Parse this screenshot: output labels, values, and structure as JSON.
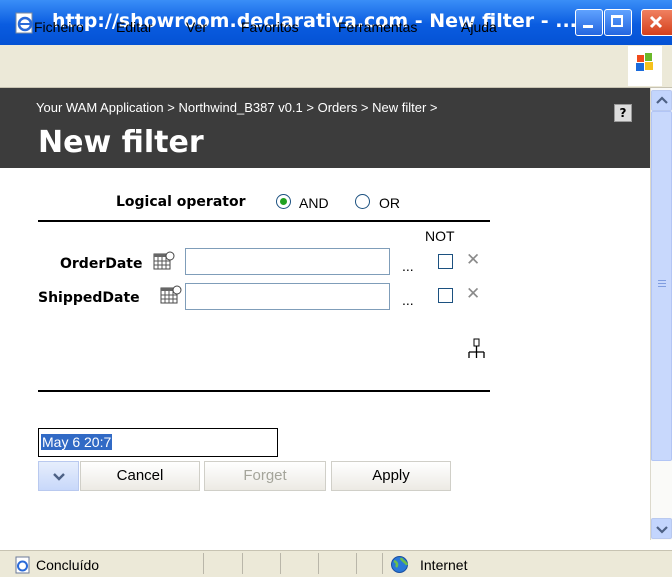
{
  "window": {
    "title": "http://showroom.declarativa.com - New filter - ...",
    "icon": "ie-page-icon"
  },
  "menu": [
    "Ficheiro",
    "Editar",
    "Ver",
    "Favoritos",
    "Ferramentas",
    "Ajuda"
  ],
  "header": {
    "breadcrumb": "Your WAM Application > Northwind_B387 v0.1 > Orders > New filter >",
    "title": "New filter",
    "help": "?"
  },
  "filter": {
    "logical_operator_label": "Logical operator",
    "options": [
      {
        "label": "AND",
        "selected": true
      },
      {
        "label": "OR",
        "selected": false
      }
    ],
    "not_header": "NOT",
    "fields": [
      {
        "label": "OrderDate",
        "value": "",
        "ellipsis": "...",
        "not_checked": false,
        "remove": "✕"
      },
      {
        "label": "ShippedDate",
        "value": "",
        "ellipsis": "...",
        "not_checked": false,
        "remove": "✕"
      }
    ]
  },
  "footer": {
    "name_value": "May 6 20:7",
    "cancel": "Cancel",
    "forget": "Forget",
    "apply": "Apply"
  },
  "status": {
    "text": "Concluído",
    "zone": "Internet"
  },
  "colors": {
    "titlebar": "#0a5ce0",
    "header_bg": "#3c3c3c",
    "selection": "#316ac5"
  }
}
